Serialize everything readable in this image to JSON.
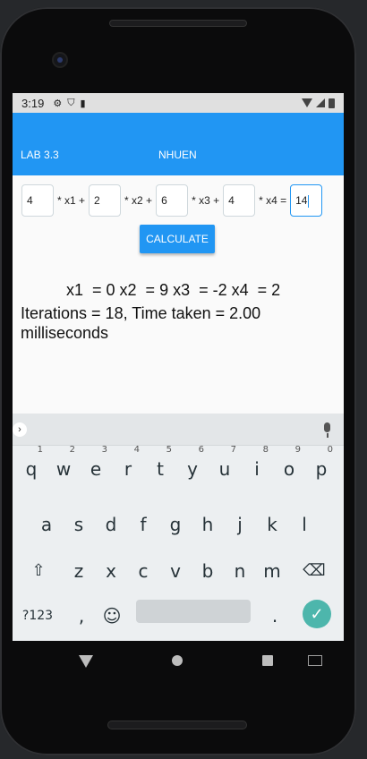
{
  "statusbar": {
    "time": "3:19"
  },
  "appbar": {
    "left_title": "LAB 3.3",
    "center_title": "NHUEN"
  },
  "equation": {
    "coefficients": [
      "4",
      "2",
      "6",
      "4",
      "14"
    ],
    "operators": [
      "* x1 +",
      "* x2 +",
      "* x3 +",
      "* x4 ="
    ]
  },
  "calculate_label": "CALCULATE",
  "result": {
    "solution": "x1  = 0 x2  = 9 x3  = -2 x4  = 2",
    "stats": "Iterations = 18, Time taken = 2.00 milliseconds"
  },
  "keyboard": {
    "row1": [
      "q",
      "w",
      "e",
      "r",
      "t",
      "y",
      "u",
      "i",
      "o",
      "p"
    ],
    "row1_hints": [
      "1",
      "2",
      "3",
      "4",
      "5",
      "6",
      "7",
      "8",
      "9",
      "0"
    ],
    "row2": [
      "a",
      "s",
      "d",
      "f",
      "g",
      "h",
      "j",
      "k",
      "l"
    ],
    "row3": [
      "z",
      "x",
      "c",
      "v",
      "b",
      "n",
      "m"
    ],
    "symbols_label": "?123",
    "comma": ",",
    "period": "."
  },
  "colors": {
    "accent": "#2196f3",
    "enter": "#4db6ac"
  },
  "icons": [
    "gear-icon",
    "shield-icon",
    "sd-card-icon",
    "wifi-icon",
    "cell-signal-icon",
    "battery-icon",
    "mic-icon",
    "chevron-right-icon",
    "shift-icon",
    "backspace-icon",
    "emoji-icon",
    "checkmark-icon",
    "back-nav-icon",
    "home-nav-icon",
    "recents-nav-icon",
    "keyboard-switch-icon"
  ]
}
